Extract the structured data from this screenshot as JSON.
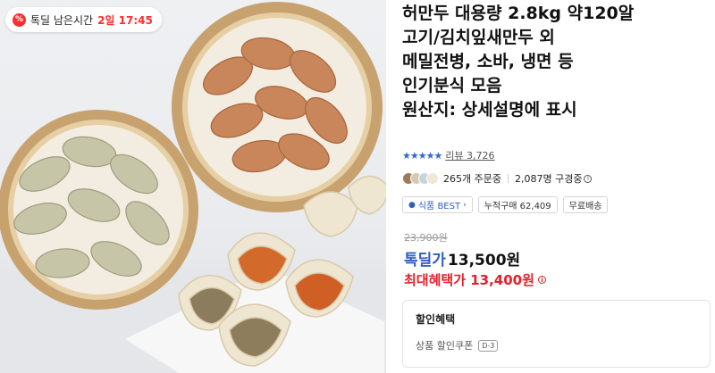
{
  "deal_timer": {
    "icon": "percent-icon",
    "label": "톡딜 남은시간",
    "value": "2일 17:45"
  },
  "product": {
    "title_lines": [
      "허만두 대용량 2.8kg 약120알",
      "고기/김치잎새만두 외",
      "메밀전병, 소바, 냉면 등",
      "인기분식 모음",
      "원산지: 상세설명에 표시"
    ],
    "rating": {
      "stars": "★★★★★",
      "review_label": "리뷰 3,726"
    },
    "social": {
      "orders": "265개 주문중",
      "viewers": "2,087명 구경중"
    },
    "badges": {
      "food_best": "식품 BEST",
      "cumulative": "누적구매 62,409",
      "free_shipping": "무료배송"
    },
    "price": {
      "original": "23,900원",
      "deal_label": "톡딜가",
      "deal_value": "13,500원",
      "max_benefit": "최대혜택가 13,400원"
    },
    "discount": {
      "title": "할인혜택",
      "coupon_label": "상품 할인쿠폰",
      "coupon_dday": "D-3"
    }
  },
  "colors": {
    "accent_blue": "#2f5fc4",
    "accent_red": "#e3202a",
    "timer_red": "#ff2d2d"
  }
}
